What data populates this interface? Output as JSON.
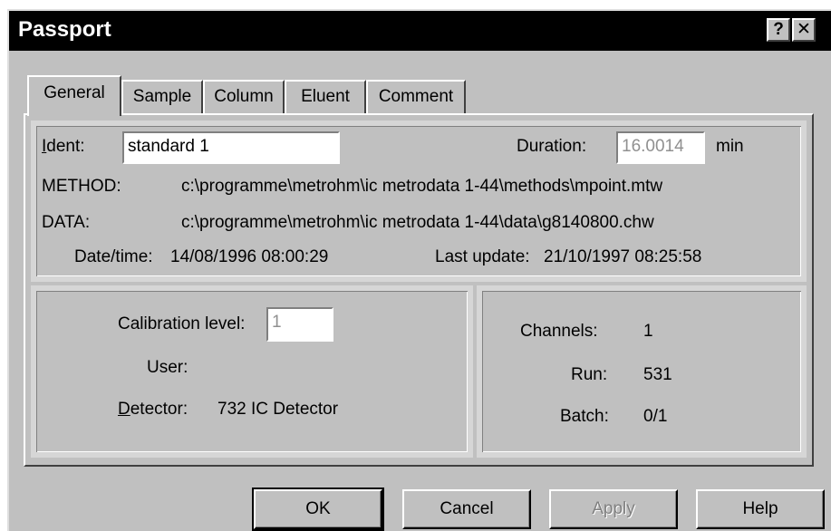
{
  "window": {
    "title": "Passport",
    "help_glyph": "?",
    "close_glyph": "✕"
  },
  "tabs": [
    {
      "label": "General",
      "active": true
    },
    {
      "label": "Sample"
    },
    {
      "label": "Column"
    },
    {
      "label": "Eluent"
    },
    {
      "label": "Comment"
    }
  ],
  "general": {
    "ident_label_mnemonic": "I",
    "ident_label_rest": "dent:",
    "ident_value": "standard 1",
    "duration_label": "Duration:",
    "duration_value": "16.0014",
    "duration_unit": "min",
    "method_label": "METHOD:",
    "method_value": "c:\\programme\\metrohm\\ic metrodata 1-44\\methods\\mpoint.mtw",
    "data_label": "DATA:",
    "data_value": "c:\\programme\\metrohm\\ic metrodata 1-44\\data\\g8140800.chw",
    "datetime_label": "Date/time:",
    "datetime_value": "14/08/1996 08:00:29",
    "last_update_label": "Last update:",
    "last_update_value": "21/10/1997 08:25:58"
  },
  "calibration": {
    "level_label": "Calibration level:",
    "level_value": "1",
    "user_label": "User:",
    "user_value": "",
    "detector_label_mnemonic": "D",
    "detector_label_rest": "etector:",
    "detector_value": "732 IC Detector"
  },
  "run_info": {
    "channels_label": "Channels:",
    "channels_value": "1",
    "run_label": "Run:",
    "run_value": "531",
    "batch_label": "Batch:",
    "batch_value": "0/1"
  },
  "buttons": {
    "ok": "OK",
    "cancel": "Cancel",
    "apply": "Apply",
    "help": "Help"
  }
}
